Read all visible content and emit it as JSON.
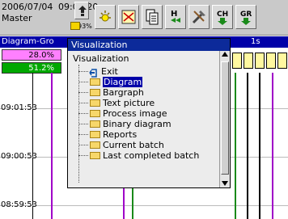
{
  "status": {
    "date": "2006/07/04",
    "time": "09:02:20",
    "user": "Master",
    "battery": "93%"
  },
  "toolbar": {
    "buttons": [
      "navigation-icon",
      "alarm-icon",
      "display-icon",
      "copy-icon",
      "history-icon",
      "tools-icon",
      "channel-icon",
      "group-icon"
    ],
    "button_labels": {
      "channel": "CH",
      "group": "GR"
    }
  },
  "header": {
    "group_name": "Diagram-Gro",
    "interval": "1s"
  },
  "values": {
    "v1": "28.0%",
    "v2": "51.2%"
  },
  "timeline": [
    "09:01:53",
    "09:00:53",
    "08:59:53"
  ],
  "popup": {
    "title": "Visualization",
    "root": "Visualization",
    "items": [
      {
        "label": "Exit",
        "selected": false
      },
      {
        "label": "Diagram",
        "selected": true
      },
      {
        "label": "Bargraph",
        "selected": false
      },
      {
        "label": "Text picture",
        "selected": false
      },
      {
        "label": "Process image",
        "selected": false
      },
      {
        "label": "Binary diagram",
        "selected": false
      },
      {
        "label": "Reports",
        "selected": false
      },
      {
        "label": "Current batch",
        "selected": false
      },
      {
        "label": "Last completed batch",
        "selected": false
      }
    ]
  },
  "colors": {
    "header_bg": "#0000a8",
    "value1_bg": "#ff80ff",
    "value2_bg": "#00a800",
    "selection": "#0000a8",
    "trace_purple": "#a000c8",
    "trace_green": "#1a8a1a",
    "trace_black": "#000000"
  }
}
